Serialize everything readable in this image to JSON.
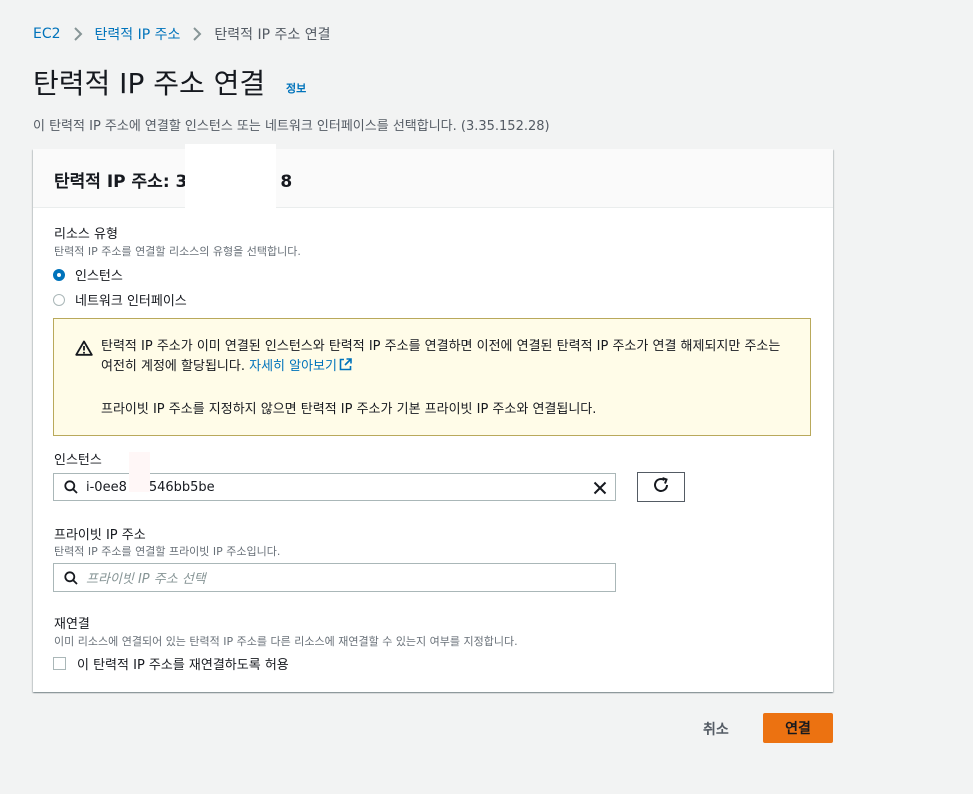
{
  "breadcrumb": {
    "ec2": "EC2",
    "eip": "탄력적 IP 주소",
    "current": "탄력적 IP 주소 연결"
  },
  "page": {
    "title": "탄력적 IP 주소 연결",
    "info": "정보",
    "description": "이 탄력적 IP 주소에 연결할 인스턴스 또는 네트워크 인터페이스를 선택합니다. (3.35.152.28)"
  },
  "panel": {
    "title_prefix": "탄력적 IP 주소: 3",
    "title_suffix": "8"
  },
  "resource_type": {
    "label": "리소스 유형",
    "description": "탄력적 IP 주소를 연결할 리소스의 유형을 선택합니다.",
    "options": [
      "인스턴스",
      "네트워크 인터페이스"
    ],
    "selected": "인스턴스"
  },
  "alert": {
    "text": "탄력적 IP 주소가 이미 연결된 인스턴스와 탄력적 IP 주소를 연결하면 이전에 연결된 탄력적 IP 주소가 연결 해제되지만 주소는 여전히 계정에 할당됩니다.",
    "link": "자세히 알아보기",
    "text2": "프라이빗 IP 주소를 지정하지 않으면 탄력적 IP 주소가 기본 프라이빗 IP 주소와 연결됩니다."
  },
  "instance": {
    "label": "인스턴스",
    "value_prefix": "i-0ee8",
    "value_suffix": "546bb5be"
  },
  "private_ip": {
    "label": "프라이빗 IP 주소",
    "description": "탄력적 IP 주소를 연결할 프라이빗 IP 주소입니다.",
    "placeholder": "프라이빗 IP 주소 선택"
  },
  "reassociate": {
    "label": "재연결",
    "description": "이미 리소스에 연결되어 있는 탄력적 IP 주소를 다른 리소스에 재연결할 수 있는지 여부를 지정합니다.",
    "checkbox_label": "이 탄력적 IP 주소를 재연결하도록 허용",
    "checked": false
  },
  "actions": {
    "cancel": "취소",
    "connect": "연결"
  },
  "colors": {
    "link": "#0073bb",
    "primary": "#ec7211",
    "warning": "#b9a95b"
  }
}
